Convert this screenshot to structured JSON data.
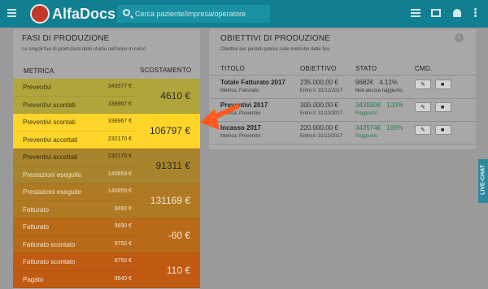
{
  "app": {
    "name": "AlfaDocs"
  },
  "topbar": {
    "search_placeholder": "Cerca paziente/impresa/operatore",
    "icons": [
      "menu-icon",
      "list-icon",
      "mail-icon",
      "bell-icon",
      "more-vert-icon"
    ]
  },
  "fasi": {
    "title": "FASI DI PRODUZIONE",
    "subtitle": "Le singoli fasi di produzioni dello studio nell'anno in corso",
    "col_metric": "METRICA",
    "col_deviation": "SCOSTAMENTO",
    "rows": [
      {
        "name": "Preventivi",
        "value": "343577 €",
        "color": "#b0a53a",
        "text_color": "#3a3513"
      },
      {
        "name": "Preventivi scontati",
        "value": "338967 €",
        "color": "#b0a53a",
        "text_color": "#3a3513"
      },
      {
        "name": "Preventivi scontati",
        "value": "338967 €",
        "color": "#ffd52a",
        "text_color": "#3a3513"
      },
      {
        "name": "Preventivi accettati",
        "value": "232170 €",
        "color": "#ffd52a",
        "text_color": "#3a3513"
      },
      {
        "name": "Preventivi accettati",
        "value": "232170 €",
        "color": "#a8852c",
        "text_color": "#3a2a10"
      },
      {
        "name": "Prestazioni eseguite",
        "value": "140859 €",
        "color": "#a8852c",
        "text_color": "#ece2cc"
      },
      {
        "name": "Prestazioni eseguite",
        "value": "140859 €",
        "color": "#b07a24",
        "text_color": "#ece2cc"
      },
      {
        "name": "Fatturato",
        "value": "9690 €",
        "color": "#b07a24",
        "text_color": "#ece2cc"
      },
      {
        "name": "Fatturato",
        "value": "9690 €",
        "color": "#b86a18",
        "text_color": "#f2e6d6"
      },
      {
        "name": "Fatturato scontato",
        "value": "9750 €",
        "color": "#b86a18",
        "text_color": "#f2e6d6"
      },
      {
        "name": "Fatturato scontato",
        "value": "9750 €",
        "color": "#c05a12",
        "text_color": "#f2e6d6"
      },
      {
        "name": "Pagato",
        "value": "9640 €",
        "color": "#c05a12",
        "text_color": "#f2e6d6"
      }
    ],
    "deviations": [
      {
        "value": "4610 €",
        "color": "#b0a53a",
        "text_color": "#2a2a2a"
      },
      {
        "value": "106797 €",
        "color": "#ffd52a",
        "text_color": "#2a2a2a"
      },
      {
        "value": "91311 €",
        "color": "#a8852c",
        "text_color": "#2a2a2a"
      },
      {
        "value": "131169 €",
        "color": "#b07a24",
        "text_color": "#f2e6d6"
      },
      {
        "value": "-60 €",
        "color": "#b86a18",
        "text_color": "#f2e6d6"
      },
      {
        "value": "110 €",
        "color": "#c05a12",
        "text_color": "#f2e6d6"
      }
    ]
  },
  "obiettivi": {
    "title": "OBIETTIVI DI PRODUZIONE",
    "subtitle": "Obiettivi per periodi precisi sulle metriche delle fasi",
    "columns": {
      "title": "TITOLO",
      "objective": "OBIETTIVO",
      "state": "STATO",
      "cmd": "CMD."
    },
    "rows": [
      {
        "title": "Totale Fatturato 2017",
        "metric": "Metrica: Fatturato",
        "objective": "235.000,00 €",
        "deadline": "Entro il: 31/12/2017",
        "state_value": "9682€",
        "state_pct": "4.12%",
        "state_note": "Non ancora raggiunto",
        "state_color": "#333333"
      },
      {
        "title": "Preventivi 2017",
        "metric": "Metrica: Preventivi",
        "objective": "300.000,00 €",
        "deadline": "Entro il: 31/12/2017",
        "state_value": "343590€",
        "state_pct": "100%",
        "state_note": "Raggiunto",
        "state_color": "#2e7d4f"
      },
      {
        "title": "Incasso 2017",
        "metric": "Metrica: Preventivi",
        "objective": "220.000,00 €",
        "deadline": "Entro il: 31/12/2017",
        "state_value": "343574€",
        "state_pct": "100%",
        "state_note": "Raggiunto",
        "state_color": "#2e7d4f"
      }
    ]
  },
  "livechat": {
    "label": "LIVE-CHAT"
  },
  "colors": {
    "topbar": "#0f7f91",
    "accent_arrow": "#ff5a1f",
    "highlight": "#ffd52a"
  }
}
